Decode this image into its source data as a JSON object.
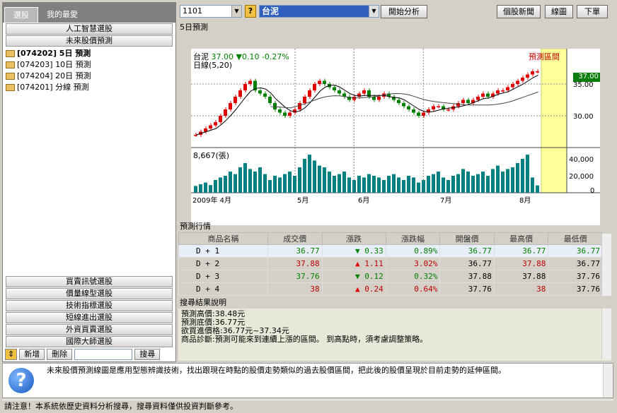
{
  "left": {
    "tabs": [
      "選股",
      "我的最愛"
    ],
    "top_buttons": [
      "人工智慧選股",
      "未來股價預測"
    ],
    "tree": [
      {
        "label": "[074202] 5日 預測",
        "open": true
      },
      {
        "label": "[074203] 10日 預測",
        "open": false
      },
      {
        "label": "[074204] 20日 預測",
        "open": false
      },
      {
        "label": "[074201] 分線 預測",
        "open": false
      }
    ],
    "bottom_buttons": [
      "買賣訊號選股",
      "價量線型選股",
      "技術指標選股",
      "短線進出選股",
      "外資買賣選股",
      "國際大師選股"
    ],
    "add_label": "新增",
    "delete_label": "刪除",
    "search_label": "搜尋",
    "search_value": ""
  },
  "topbar": {
    "code": "1101",
    "help": "?",
    "stock_name": "台泥",
    "analyze": "開始分析",
    "news": "個股新聞",
    "chart": "線圖",
    "order": "下單"
  },
  "chart_panel": {
    "title": "5日預測",
    "name": "台泥",
    "price": "37.00",
    "change": "▼0.10",
    "pct": "-0.27%",
    "line_label": "日線(5,20)",
    "forecast_label": "預測區間",
    "vol_label": "8,667(張)",
    "price_badge": "37.00",
    "y_ticks": [
      "35.00",
      "30.00"
    ],
    "vol_ticks": [
      "40,000",
      "20,000",
      "0"
    ],
    "x_labels": [
      "2009年 4月",
      "5月",
      "6月",
      "7月",
      "8月"
    ]
  },
  "chart_data": {
    "type": "candlestick",
    "title": "",
    "series": [
      {
        "name": "日線",
        "values": [
          27,
          27.5,
          28,
          28.5,
          29,
          30,
          31,
          32,
          33,
          34,
          35,
          35.5,
          34,
          33.5,
          33,
          32,
          31,
          30.5,
          30,
          30.5,
          31,
          32,
          33,
          34,
          35,
          35.5,
          35,
          34.5,
          34,
          33.5,
          33,
          32.5,
          33,
          33.5,
          34,
          33,
          32.5,
          33,
          33.5,
          33,
          32.5,
          32,
          31.5,
          31,
          30.5,
          30,
          30.5,
          31,
          31.5,
          31.5,
          31,
          31,
          31.5,
          32,
          32.5,
          32,
          32.5,
          33,
          33.5,
          33,
          33.5,
          34,
          34,
          34.5,
          35,
          35.5,
          36,
          36.5,
          37,
          37
        ]
      }
    ],
    "volume_values": [
      8000,
      10000,
      12000,
      9000,
      15000,
      18000,
      20000,
      25000,
      22000,
      30000,
      35000,
      28000,
      25000,
      30000,
      22000,
      15000,
      20000,
      18000,
      22000,
      25000,
      20000,
      30000,
      40000,
      45000,
      38000,
      32000,
      30000,
      25000,
      20000,
      22000,
      25000,
      18000,
      15000,
      20000,
      18000,
      22000,
      20000,
      18000,
      15000,
      20000,
      22000,
      18000,
      15000,
      20000,
      18000,
      12000,
      15000,
      20000,
      22000,
      25000,
      18000,
      15000,
      20000,
      22000,
      28000,
      25000,
      20000,
      22000,
      25000,
      20000,
      28000,
      32000,
      25000,
      28000,
      30000,
      35000,
      40000,
      45000,
      18000,
      8667
    ],
    "ylim": [
      25,
      40
    ],
    "vol_ylim": [
      0,
      50000
    ]
  },
  "table": {
    "title": "預測行情",
    "headers": [
      "商品名稱",
      "成交價",
      "漲跌",
      "漲跌幅",
      "開盤價",
      "最高價",
      "最低價"
    ],
    "rows": [
      {
        "name": "D + 1",
        "price": "36.77",
        "dir": "▼",
        "chg": "0.33",
        "pct": "0.89%",
        "open": "36.77",
        "high": "36.77",
        "low": "36.77",
        "pc": "grn",
        "oc": "grn",
        "hc": "grn",
        "lc": "grn"
      },
      {
        "name": "D + 2",
        "price": "37.88",
        "dir": "▲",
        "chg": "1.11",
        "pct": "3.02%",
        "open": "36.77",
        "high": "37.88",
        "low": "36.77",
        "pc": "red",
        "oc": "",
        "hc": "red",
        "lc": ""
      },
      {
        "name": "D + 3",
        "price": "37.76",
        "dir": "▼",
        "chg": "0.12",
        "pct": "0.32%",
        "open": "37.88",
        "high": "37.88",
        "low": "37.76",
        "pc": "grn",
        "oc": "",
        "hc": "",
        "lc": ""
      },
      {
        "name": "D + 4",
        "price": "38",
        "dir": "▲",
        "chg": "0.24",
        "pct": "0.64%",
        "open": "37.76",
        "high": "38",
        "low": "37.76",
        "pc": "red",
        "oc": "",
        "hc": "red",
        "lc": ""
      }
    ]
  },
  "result": {
    "title": "搜尋結果說明",
    "lines": [
      "預測高價:38.48元",
      "預測底價:36.77元",
      "欲買進價格:36.77元~37.34元",
      "商品診斷:預測可能來到連續上漲的區間。 到高點時，須考慮調整策略。"
    ]
  },
  "info": {
    "text": "未來股價預測線圖是應用型態辨識技術，找出跟現在時點的股價走勢類似的過去股價區間，把此後的股價呈現於目前走勢的延伸區間。"
  },
  "status": {
    "text": "請注意！本系統依歷史資料分析搜尋，搜尋資料僅供投資判斷參考。"
  },
  "colors": {
    "up": "#e00000",
    "down": "#008000",
    "forecast_bg": "#ffff99",
    "volume": "#008080"
  }
}
